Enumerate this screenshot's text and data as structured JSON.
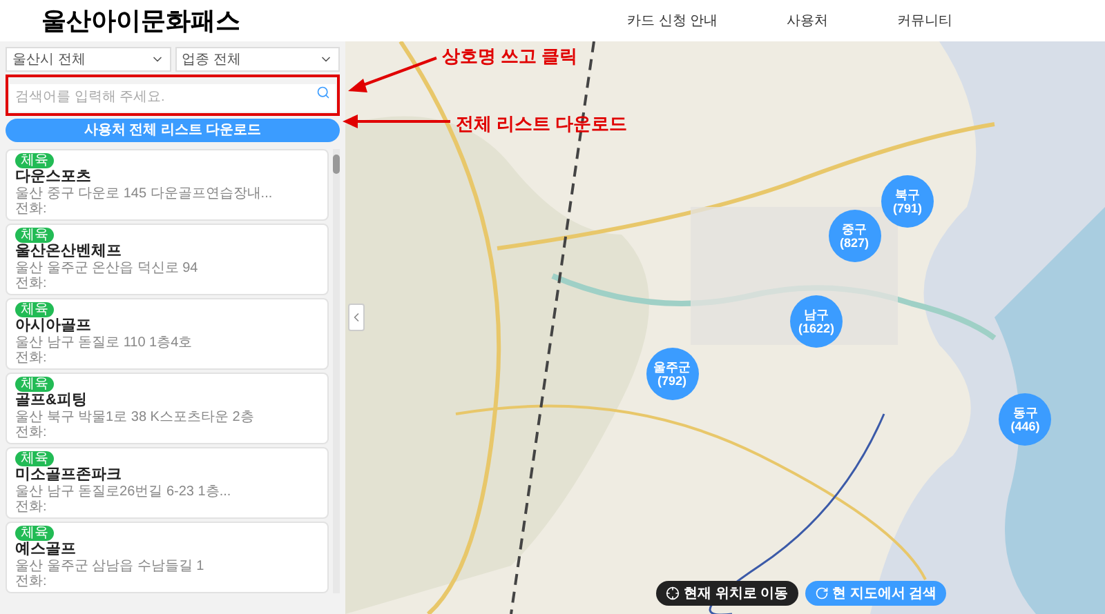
{
  "header": {
    "logo": "울산아이문화패스",
    "nav": [
      "카드 신청 안내",
      "사용처",
      "커뮤니티"
    ]
  },
  "sidebar": {
    "filters": [
      "울산시 전체",
      "업종 전체"
    ],
    "search": {
      "placeholder": "검색어를 입력해 주세요."
    },
    "download_button": "사용처 전체 리스트 다운로드",
    "places": [
      {
        "category": "체육",
        "name": "다운스포츠",
        "address": "울산 중구 다운로 145 다운골프연습장내...",
        "phone": "전화:"
      },
      {
        "category": "체육",
        "name": "울산온산벤체프",
        "address": "울산 울주군 온산읍 덕신로 94",
        "phone": "전화:"
      },
      {
        "category": "체육",
        "name": "아시아골프",
        "address": "울산 남구 돋질로 110 1층4호",
        "phone": "전화:"
      },
      {
        "category": "체육",
        "name": "골프&피팅",
        "address": "울산 북구 박물1로 38 K스포츠타운 2층",
        "phone": "전화:"
      },
      {
        "category": "체육",
        "name": "미소골프존파크",
        "address": "울산 남구 돋질로26번길 6-23 1층...",
        "phone": "전화:"
      },
      {
        "category": "체육",
        "name": "예스골프",
        "address": "울산 울주군 삼남읍 수남들길 1",
        "phone": "전화:"
      }
    ]
  },
  "map": {
    "clusters": [
      {
        "name": "북구",
        "count": "(791)"
      },
      {
        "name": "중구",
        "count": "(827)"
      },
      {
        "name": "남구",
        "count": "(1622)"
      },
      {
        "name": "울주군",
        "count": "(792)"
      },
      {
        "name": "동구",
        "count": "(446)"
      }
    ],
    "buttons": [
      {
        "kind": "locate",
        "label": "현재 위치로 이동"
      },
      {
        "kind": "refresh",
        "label": "현 지도에서 검색"
      }
    ]
  },
  "annotations": [
    "상호명 쓰고 클릭",
    "전체 리스트 다운로드"
  ]
}
